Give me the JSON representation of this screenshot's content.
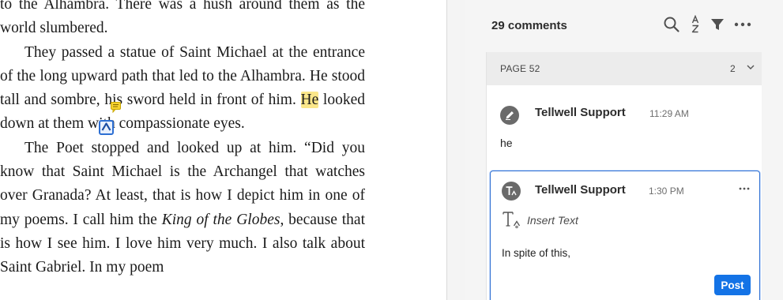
{
  "document": {
    "p0": "to the Alhambra. There was a hush around them as the world slumbered.",
    "p1_a": "They passed a statue of Saint Michael at the entrance of the long upward path that led to the Alhambra. He stood tall and sombre, his sword held in front of him. ",
    "p1_hl": "He",
    "p1_b": " looked down at them with compassionate eyes.",
    "p2_a": "The Poet stopped and looked up at him. “Did you know that Saint Michael is the Archangel that watches over Granada? At least, that is how I depict him in one of my poems. I call him the ",
    "p2_italic1": "King of the Globes",
    "p2_b": ", because that is how I see him. I love him very much. I also talk about Saint Gabriel. In my poem"
  },
  "comments_panel": {
    "count_label": "29 comments",
    "page_label": "PAGE 52",
    "page_comment_count": "2",
    "comments": [
      {
        "author": "Tellwell Support",
        "time": "11:29 AM",
        "body": "he",
        "icon": "pen-avatar-icon"
      },
      {
        "author": "Tellwell Support",
        "time": "1:30 PM",
        "type_label": "Insert Text",
        "reply_text": "In spite of this,",
        "icon": "insert-text-avatar-icon"
      }
    ],
    "post_label": "Post"
  },
  "colors": {
    "accent": "#1473e6",
    "highlight": "#fbe78a",
    "selection_border": "#2d6fd3"
  }
}
